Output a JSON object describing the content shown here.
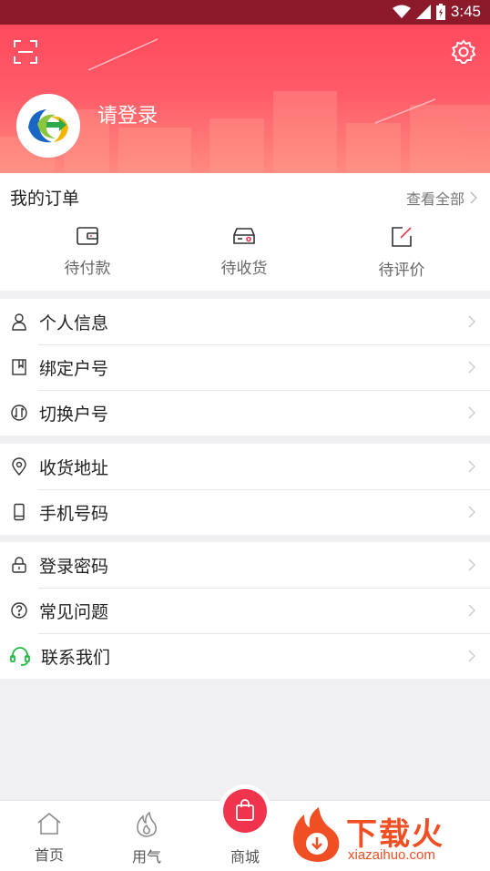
{
  "status_bar": {
    "time": "3:45"
  },
  "header": {
    "login_text": "请登录"
  },
  "orders": {
    "title": "我的订单",
    "view_all": "查看全部",
    "items": [
      {
        "label": "待付款",
        "icon": "wallet-icon"
      },
      {
        "label": "待收货",
        "icon": "truck-icon"
      },
      {
        "label": "待评价",
        "icon": "edit-icon"
      }
    ]
  },
  "menu": {
    "group1": [
      {
        "label": "个人信息",
        "icon": "user-icon"
      },
      {
        "label": "绑定户号",
        "icon": "bookmark-icon"
      },
      {
        "label": "切换户号",
        "icon": "switch-icon"
      }
    ],
    "group2": [
      {
        "label": "收货地址",
        "icon": "location-icon"
      },
      {
        "label": "手机号码",
        "icon": "phone-icon"
      }
    ],
    "group3": [
      {
        "label": "登录密码",
        "icon": "lock-icon"
      },
      {
        "label": "常见问题",
        "icon": "question-icon"
      },
      {
        "label": "联系我们",
        "icon": "headset-icon"
      }
    ]
  },
  "bottom_nav": [
    {
      "label": "首页",
      "icon": "home-icon"
    },
    {
      "label": "用气",
      "icon": "flame-icon"
    },
    {
      "label": "商城",
      "icon": "shopping-bag-icon"
    }
  ],
  "watermark": {
    "text": "下载火",
    "sub": "xiazaihuo.com"
  },
  "colors": {
    "brand": "#ff4a5e",
    "status_bar": "#8c1a2b",
    "mall": "#f0344e",
    "headset": "#22bb44"
  }
}
